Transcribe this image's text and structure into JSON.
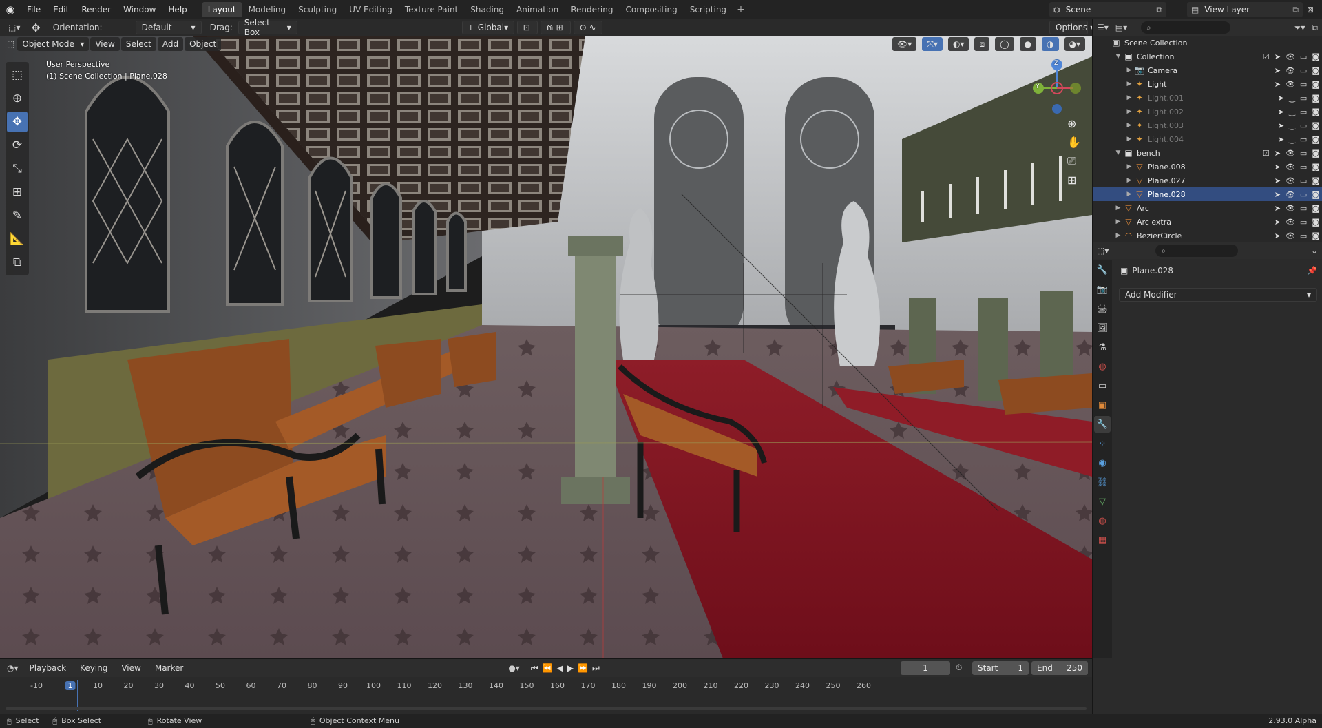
{
  "app": {
    "menu": [
      "File",
      "Edit",
      "Render",
      "Window",
      "Help"
    ]
  },
  "workspaces": [
    "Layout",
    "Modeling",
    "Sculpting",
    "UV Editing",
    "Texture Paint",
    "Shading",
    "Animation",
    "Rendering",
    "Compositing",
    "Scripting"
  ],
  "active_workspace": "Layout",
  "scene": {
    "name": "Scene",
    "view_layer": "View Layer"
  },
  "tool_header": {
    "orientation_label": "Orientation:",
    "orientation_value": "Default",
    "drag_label": "Drag:",
    "drag_value": "Select Box",
    "transform_space": "Global",
    "options": "Options"
  },
  "viewport_header": {
    "mode": "Object Mode",
    "menus": [
      "View",
      "Select",
      "Add",
      "Object"
    ]
  },
  "viewport": {
    "perspective": "User Perspective",
    "context": "(1) Scene Collection | Plane.028",
    "gizmo_axes": {
      "z": "Z",
      "y": "Y",
      "x": "X"
    }
  },
  "outliner": {
    "root": "Scene Collection",
    "rows": [
      {
        "name": "Collection",
        "indent": 1,
        "icon": "collection",
        "color": "#e0e0e0"
      },
      {
        "name": "Camera",
        "indent": 2,
        "icon": "camera",
        "color": "#e0e0e0"
      },
      {
        "name": "Light",
        "indent": 2,
        "icon": "light",
        "color": "#e0e0e0"
      },
      {
        "name": "Light.001",
        "indent": 2,
        "icon": "light",
        "color": "#7a7a7a"
      },
      {
        "name": "Light.002",
        "indent": 2,
        "icon": "light",
        "color": "#7a7a7a"
      },
      {
        "name": "Light.003",
        "indent": 2,
        "icon": "light",
        "color": "#7a7a7a"
      },
      {
        "name": "Light.004",
        "indent": 2,
        "icon": "light",
        "color": "#7a7a7a"
      },
      {
        "name": "bench",
        "indent": 1,
        "icon": "collection",
        "color": "#e0e0e0"
      },
      {
        "name": "Plane.008",
        "indent": 2,
        "icon": "mesh",
        "color": "#e0e0e0"
      },
      {
        "name": "Plane.027",
        "indent": 2,
        "icon": "mesh",
        "color": "#e0e0e0"
      },
      {
        "name": "Plane.028",
        "indent": 2,
        "icon": "mesh",
        "color": "#ffffff"
      },
      {
        "name": "Arc",
        "indent": 1,
        "icon": "mesh",
        "color": "#e0e0e0"
      },
      {
        "name": "Arc extra",
        "indent": 1,
        "icon": "mesh",
        "color": "#e0e0e0"
      },
      {
        "name": "BezierCircle",
        "indent": 1,
        "icon": "curve",
        "color": "#e0e0e0"
      }
    ]
  },
  "properties": {
    "object_name": "Plane.028",
    "add_modifier": "Add Modifier"
  },
  "timeline": {
    "menus": [
      "Playback",
      "Keying",
      "View",
      "Marker"
    ],
    "current_frame": "1",
    "start_label": "Start",
    "start": "1",
    "end_label": "End",
    "end": "250",
    "ticks": [
      "-10",
      "1",
      "10",
      "20",
      "30",
      "40",
      "50",
      "60",
      "70",
      "80",
      "90",
      "100",
      "110",
      "120",
      "130",
      "140",
      "150",
      "160",
      "170",
      "180",
      "190",
      "200",
      "210",
      "220",
      "230",
      "240",
      "250",
      "260"
    ]
  },
  "status": {
    "select": "Select",
    "box_select": "Box Select",
    "rotate": "Rotate View",
    "context_menu": "Object Context Menu",
    "version": "2.93.0 Alpha"
  }
}
